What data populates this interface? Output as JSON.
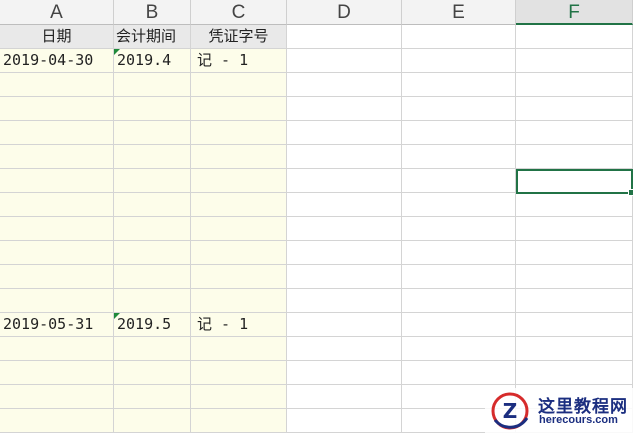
{
  "columns": [
    "A",
    "B",
    "C",
    "D",
    "E",
    "F"
  ],
  "active_column": "F",
  "header_row": {
    "a": "日期",
    "b": "会计期间",
    "c": "凭证字号"
  },
  "entries": [
    {
      "date": "2019-04-30",
      "period": "2019.4",
      "voucher": "记 - 1"
    },
    {
      "date": "2019-05-31",
      "period": "2019.5",
      "voucher": "记 - 1"
    }
  ],
  "watermark": {
    "logo_letter": "Z",
    "title": "这里教程网",
    "url": "herecours.com"
  },
  "colors": {
    "accent": "#217346",
    "fill": "#fdfdea",
    "header_bg": "#e9e9e9",
    "watermark_text": "#1b2e80",
    "watermark_logo": "#d62b2b"
  }
}
